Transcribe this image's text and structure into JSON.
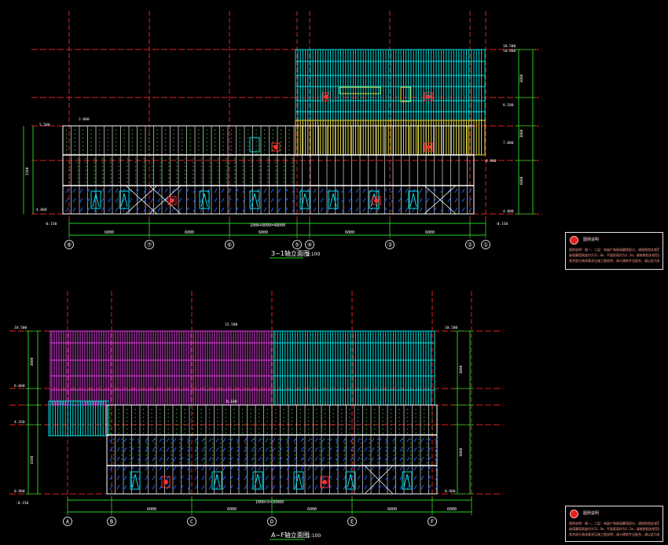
{
  "colors": {
    "background": "#000000",
    "axis": "#e02020",
    "dimension": "#20d020",
    "frame": "#ffffff",
    "cyan_panel": "#00e0e0",
    "magenta_panel": "#e040e0",
    "yellow_panel": "#e8e040",
    "hatch": "#2060ff",
    "window_red": "#ff3030"
  },
  "elevation_top": {
    "title": "3~1轴立面图",
    "scale": "1:100",
    "axes": [
      "⑧",
      "⑦",
      "⑥",
      "⑤",
      "④",
      "③",
      "②",
      "①"
    ],
    "level_labels": [
      "10.500",
      "10.000",
      "8.500",
      "7.000",
      "5.500",
      "4.000",
      "0.900",
      "-0.150"
    ],
    "dimension_total": "1000+8000=48000",
    "dimension_segments": [
      "6000",
      "6000",
      "6000",
      "6000",
      "6000",
      "6000"
    ],
    "side_dimensions": [
      "3000",
      "3000",
      "6000",
      "1500"
    ]
  },
  "elevation_bottom": {
    "title": "A~F轴立面图",
    "scale": "1:100",
    "axes": [
      "A",
      "B",
      "C",
      "D",
      "E",
      "F"
    ],
    "level_labels": [
      "10.500",
      "10.500",
      "6.000",
      "4.350",
      "0.900",
      "0.900",
      "-0.150"
    ],
    "dimension_total": "1000×5=30000",
    "dimension_segments": [
      "6000",
      "6000",
      "6000",
      "6000",
      "6000"
    ],
    "side_dimensions": [
      "3000",
      "4500",
      "3000",
      "6000"
    ]
  },
  "notes": [
    {
      "title": "图例说明",
      "lines": [
        "图例说明：图一、二层：有窗户和玻璃幕墙部分，请按照相关规范执行。",
        "玻璃幕墙高度约为11.3m，平面距离约为2.2m，请按照相关规范执行。",
        "其余部分具体要求见施工图说明，请与建筑专业配合，请以此为准。"
      ]
    },
    {
      "title": "图例说明",
      "lines": [
        "图例说明：图一、二层：有窗户和玻璃幕墙部分，请按照相关规范执行。",
        "玻璃幕墙高度约为11.3m，平面距离约为2.2m，请按照相关规范执行。",
        "其余部分具体要求见施工图说明，请与建筑专业配合，请以此为准。"
      ]
    }
  ]
}
